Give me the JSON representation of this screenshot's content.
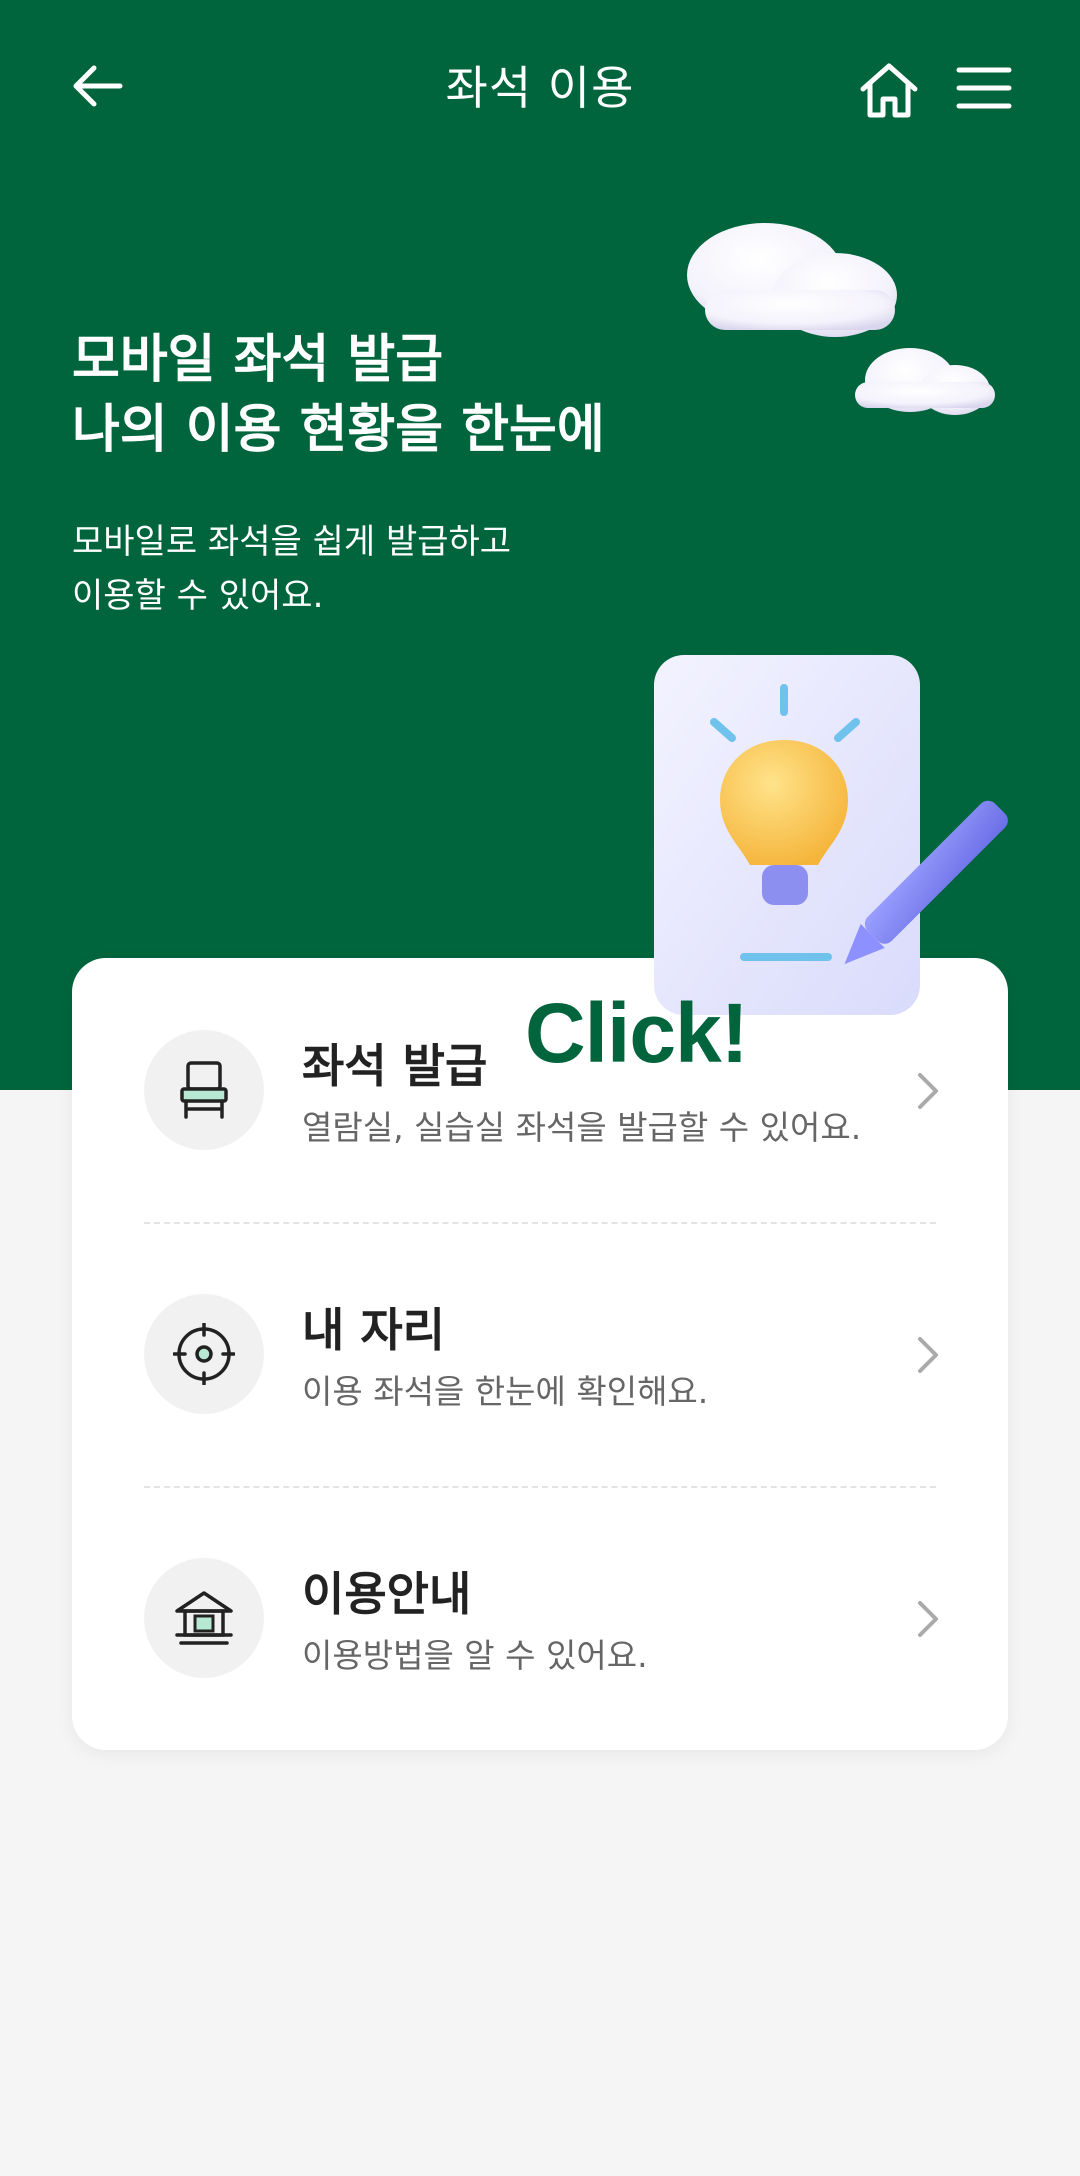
{
  "header": {
    "title": "좌석 이용",
    "back_icon": "arrow-left-icon",
    "home_icon": "home-icon",
    "menu_icon": "hamburger-menu-icon"
  },
  "hero": {
    "heading_line1": "모바일 좌석 발급",
    "heading_line2": "나의 이용 현황을 한눈에",
    "sub_line1": "모바일로 좌석을 쉽게 발급하고",
    "sub_line2": "이용할 수 있어요.",
    "illustration_label": "Click!"
  },
  "menu": {
    "items": [
      {
        "title": "좌석 발급",
        "desc": "열람실, 실습실 좌석을 발급할 수 있어요.",
        "icon": "chair-icon"
      },
      {
        "title": "내 자리",
        "desc": "이용 좌석을 한눈에 확인해요.",
        "icon": "target-icon"
      },
      {
        "title": "이용안내",
        "desc": "이용방법을 알 수 있어요.",
        "icon": "building-icon"
      }
    ]
  },
  "colors": {
    "brand_green": "#00653c",
    "background": "#f5f5f5",
    "card": "#ffffff"
  }
}
